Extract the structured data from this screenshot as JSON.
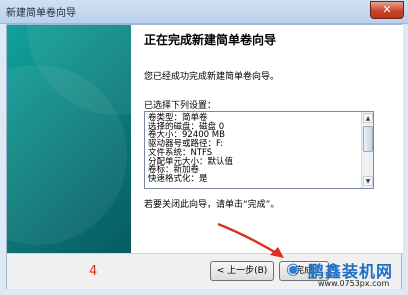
{
  "window": {
    "title": "新建简单卷向导",
    "close_glyph": "✕"
  },
  "wizard": {
    "heading": "正在完成新建简单卷向导",
    "description": "您已经成功完成新建简单卷向导。",
    "selected_label": "已选择下列设置：",
    "settings_text": "卷类型：简单卷\n选择的磁盘：磁盘 0\n卷大小：92400 MB\n驱动器号或路径：F:\n文件系统：NTFS\n分配单元大小：默认值\n卷标：新加卷\n快速格式化：是",
    "finish_note": "若要关闭此向导，请单击“完成”。"
  },
  "footer": {
    "step_number": "4",
    "back_label": "< 上一步(B)",
    "finish_label": "完成"
  },
  "watermark": {
    "brand": "鹏鑫装机网",
    "url": "www.0753px.com"
  },
  "colors": {
    "banner": "#0e8a86",
    "annotation": "#d9301e",
    "watermark": "#1e6fc4"
  }
}
